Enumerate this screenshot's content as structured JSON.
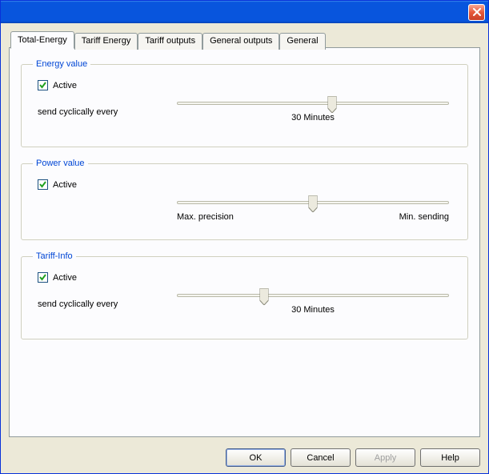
{
  "tabs": [
    {
      "label": "Total-Energy"
    },
    {
      "label": "Tariff Energy"
    },
    {
      "label": "Tariff outputs"
    },
    {
      "label": "General outputs"
    },
    {
      "label": "General"
    }
  ],
  "energy_value": {
    "legend": "Energy value",
    "active_label": "Active",
    "active_checked": true,
    "send_label": "send cyclically every",
    "slider_pos_pct": 57,
    "value_label": "30 Minutes"
  },
  "power_value": {
    "legend": "Power value",
    "active_label": "Active",
    "active_checked": true,
    "left_label": "Max. precision",
    "right_label": "Min. sending",
    "slider_pos_pct": 50
  },
  "tariff_info": {
    "legend": "Tariff-Info",
    "active_label": "Active",
    "active_checked": true,
    "send_label": "send cyclically every",
    "slider_pos_pct": 32,
    "value_label": "30 Minutes"
  },
  "buttons": {
    "ok": "OK",
    "cancel": "Cancel",
    "apply": "Apply",
    "help": "Help"
  }
}
